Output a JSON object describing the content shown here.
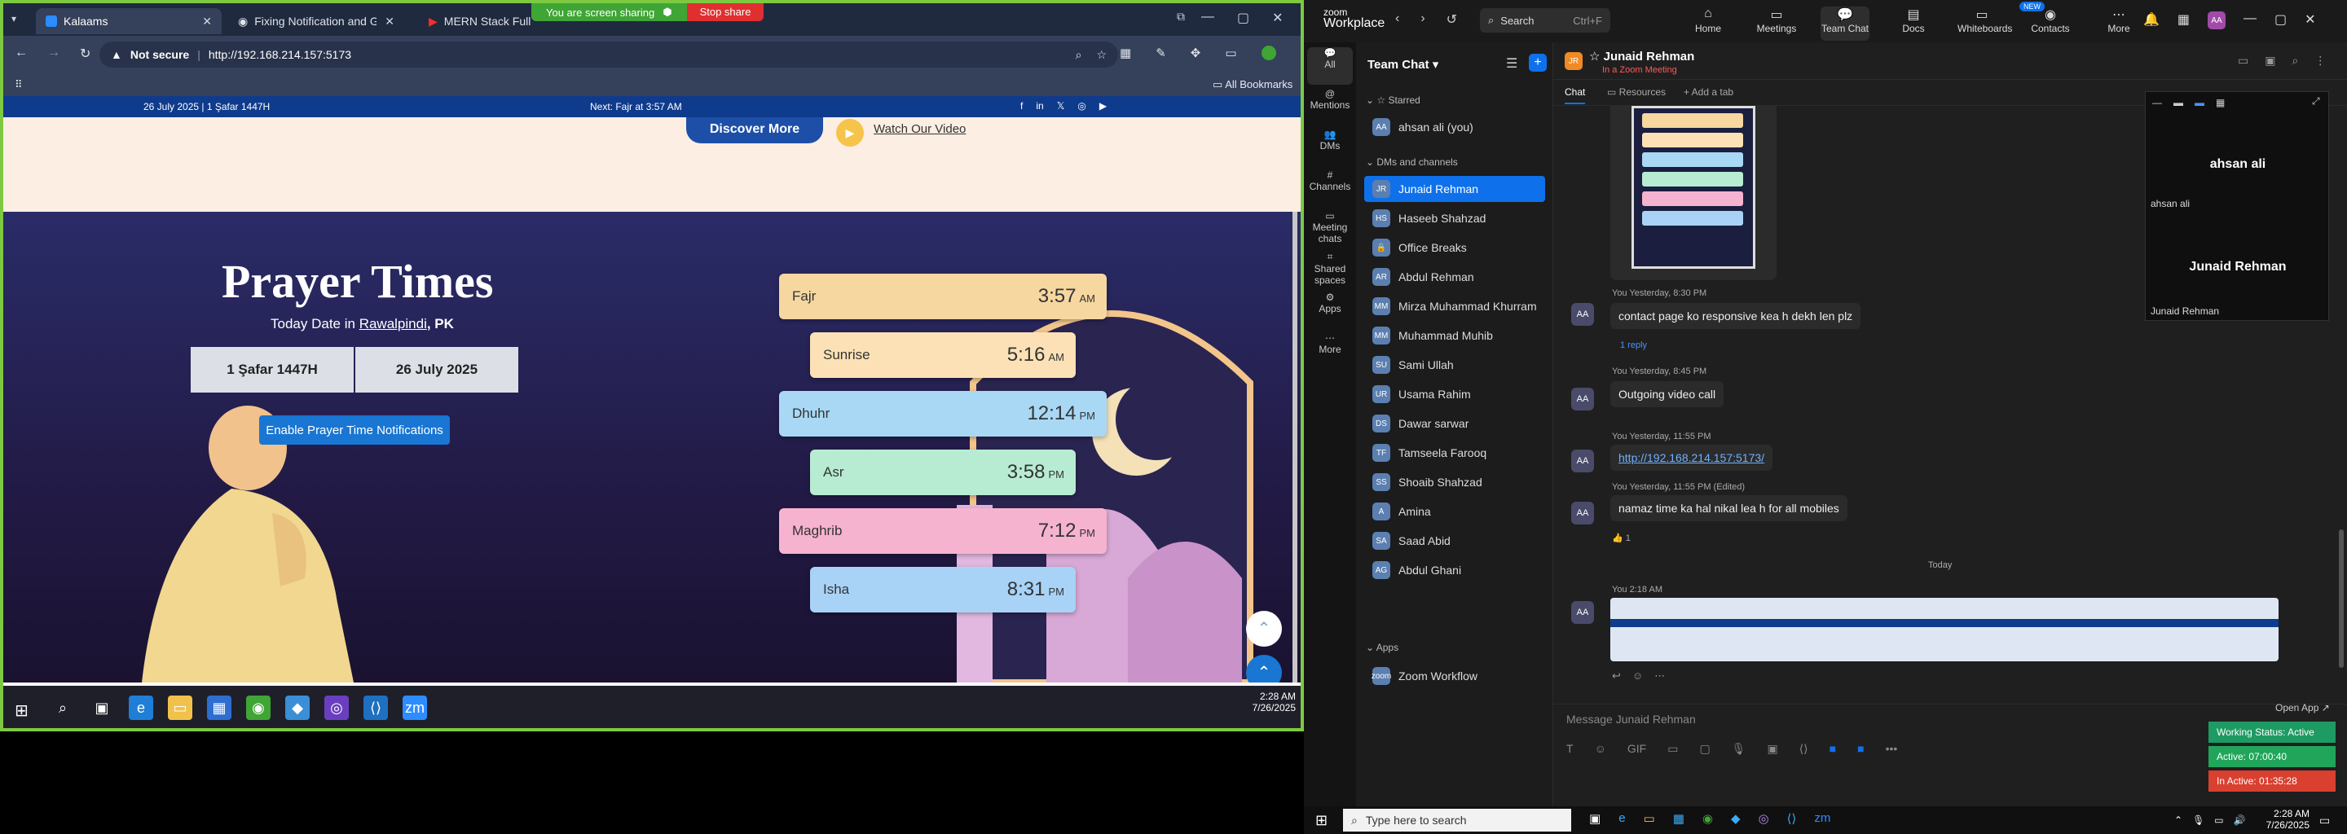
{
  "browser": {
    "tabs": [
      {
        "label": "Kalaams",
        "active": true
      },
      {
        "label": "Fixing Notification and Geoloca",
        "active": false
      },
      {
        "label": "MERN Stack Full Cou",
        "active": false
      }
    ],
    "share_banner": {
      "status": "You are screen sharing",
      "stop": "Stop share"
    },
    "security": "Not secure",
    "url": "http://192.168.214.157:5173",
    "all_bookmarks": "All Bookmarks"
  },
  "site": {
    "date_hijri": "26 July 2025 | 1 Şafar 1447H",
    "next_prayer": "Next: Fajr at 3:57 AM",
    "discover": "Discover More",
    "watch": "Watch Our Video",
    "title": "Prayer Times",
    "today_prefix": "Today Date in ",
    "city": "Rawalpindi",
    "country": ", PK",
    "hijri_box": "1 Şafar 1447H",
    "greg_box": "26 July 2025",
    "enable": "Enable Prayer Time Notifications",
    "prayers": [
      {
        "name": "Fajr",
        "time": "3:57",
        "ampm": "AM",
        "color": "#f6d7a0"
      },
      {
        "name": "Sunrise",
        "time": "5:16",
        "ampm": "AM",
        "color": "#fbe1b5"
      },
      {
        "name": "Dhuhr",
        "time": "12:14",
        "ampm": "PM",
        "color": "#a9d8f5"
      },
      {
        "name": "Asr",
        "time": "3:58",
        "ampm": "PM",
        "color": "#b7ecd3"
      },
      {
        "name": "Maghrib",
        "time": "7:12",
        "ampm": "PM",
        "color": "#f6b3cf"
      },
      {
        "name": "Isha",
        "time": "8:31",
        "ampm": "PM",
        "color": "#a8d3f7"
      }
    ]
  },
  "left_taskbar": {
    "time": "2:28 AM",
    "date": "7/26/2025"
  },
  "zoom": {
    "brand_line1": "zoom",
    "brand_line2": "Workplace",
    "search": "Search",
    "search_shortcut": "Ctrl+F",
    "nav": [
      "Home",
      "Meetings",
      "Team Chat",
      "Docs",
      "Whiteboards",
      "Contacts",
      "More"
    ],
    "nav_badge": "NEW",
    "sidebar": [
      "All",
      "Mentions",
      "DMs",
      "Channels",
      "Meeting chats",
      "Shared spaces",
      "Apps",
      "More"
    ],
    "list_title": "Team Chat",
    "sections": {
      "starred": "Starred",
      "dms": "DMs and channels",
      "apps": "Apps"
    },
    "starred": [
      {
        "initials": "AA",
        "name": "ahsan ali (you)"
      }
    ],
    "dms": [
      {
        "initials": "JR",
        "name": "Junaid Rehman",
        "selected": true
      },
      {
        "initials": "HS",
        "name": "Haseeb Shahzad"
      },
      {
        "initials": "🔒",
        "name": "Office Breaks"
      },
      {
        "initials": "AR",
        "name": "Abdul Rehman"
      },
      {
        "initials": "MM",
        "name": "Mirza Muhammad Khurram"
      },
      {
        "initials": "MM",
        "name": "Muhammad Muhib"
      },
      {
        "initials": "SU",
        "name": "Sami Ullah"
      },
      {
        "initials": "UR",
        "name": "Usama Rahim"
      },
      {
        "initials": "DS",
        "name": "Dawar sarwar"
      },
      {
        "initials": "TF",
        "name": "Tamseela Farooq"
      },
      {
        "initials": "SS",
        "name": "Shoaib Shahzad"
      },
      {
        "initials": "A",
        "name": "Amina"
      },
      {
        "initials": "SA",
        "name": "Saad Abid"
      },
      {
        "initials": "AG",
        "name": "Abdul Ghani"
      }
    ],
    "apps": [
      {
        "initials": "zoom",
        "name": "Zoom Workflow"
      }
    ],
    "chat_header": {
      "initials": "JR",
      "name": "Junaid Rehman",
      "status": "In a Zoom Meeting"
    },
    "chat_tabs": [
      "Chat",
      "Resources",
      "+ Add a tab"
    ],
    "messages": [
      {
        "meta": "You Yesterday, 8:30 PM",
        "text": "contact page ko responsive kea h dekh len plz"
      },
      {
        "meta": "1 reply",
        "text": ""
      },
      {
        "meta": "You Yesterday, 8:45 PM",
        "text": "Outgoing video call"
      },
      {
        "meta": "You Yesterday, 11:55 PM",
        "text": "http://192.168.214.157:5173/"
      },
      {
        "meta": "You Yesterday, 11:55 PM (Edited)",
        "text": "namaz time ka hal nikal lea h for all mobiles"
      },
      {
        "meta": "👍 1",
        "text": ""
      },
      {
        "meta": "You 2:18 AM",
        "text": ""
      }
    ],
    "today": "Today",
    "composer_placeholder": "Message Junaid Rehman",
    "video": {
      "name_top": "ahsan ali",
      "name_label": "ahsan ali",
      "name_bottom": "Junaid Rehman",
      "name_bottom_label": "Junaid Rehman"
    },
    "open_app": "Open App ↗",
    "work_status": [
      "Working Status: Active",
      "Active: 07:00:40",
      "In Active: 01:35:28"
    ]
  },
  "win_taskbar": {
    "search": "Type here to search",
    "time": "2:28 AM",
    "date": "7/26/2025"
  }
}
